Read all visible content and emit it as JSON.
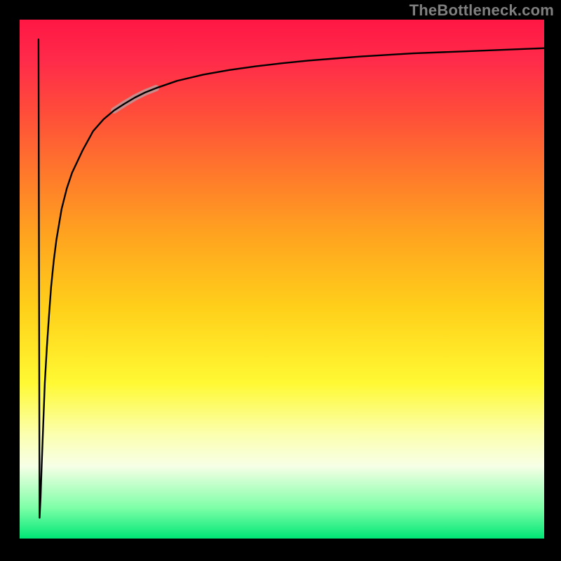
{
  "watermark": "TheBottleneck.com",
  "gradient": {
    "top": "#ff1744",
    "mid": "#ffd11a",
    "bottom": "#00e676"
  },
  "chart_data": {
    "type": "line",
    "title": "",
    "xlabel": "",
    "ylabel": "",
    "xlim": [
      0,
      100
    ],
    "ylim": [
      0,
      100
    ],
    "grid": false,
    "legend": false,
    "series": [
      {
        "name": "bottleneck-curve",
        "color": "#000000",
        "x": [
          3.6,
          3.8,
          4.0,
          4.2,
          4.5,
          4.8,
          5.2,
          5.6,
          6.0,
          6.5,
          7.0,
          8.0,
          9.0,
          10.0,
          12.0,
          14.0,
          16.0,
          18.0,
          20.0,
          22.0,
          24.0,
          26.0,
          30.0,
          35.0,
          40.0,
          45.0,
          50.0,
          55.0,
          60.0,
          65.0,
          70.0,
          75.0,
          80.0,
          85.0,
          90.0,
          95.0,
          100.0
        ],
        "y": [
          96.2,
          4.0,
          8.0,
          14.0,
          22.0,
          30.0,
          37.0,
          43.0,
          48.5,
          53.5,
          57.5,
          63.5,
          67.5,
          70.5,
          74.8,
          78.5,
          80.8,
          82.5,
          83.8,
          85.0,
          86.0,
          86.8,
          88.2,
          89.4,
          90.3,
          91.0,
          91.6,
          92.1,
          92.5,
          92.9,
          93.2,
          93.5,
          93.7,
          93.9,
          94.1,
          94.3,
          94.5
        ]
      },
      {
        "name": "highlight-segment",
        "color": "#c98c8c",
        "width": 9,
        "x": [
          18.0,
          20.0,
          22.0,
          24.0,
          26.0
        ],
        "y": [
          82.5,
          83.8,
          85.0,
          86.0,
          86.8
        ]
      }
    ],
    "annotations": []
  }
}
